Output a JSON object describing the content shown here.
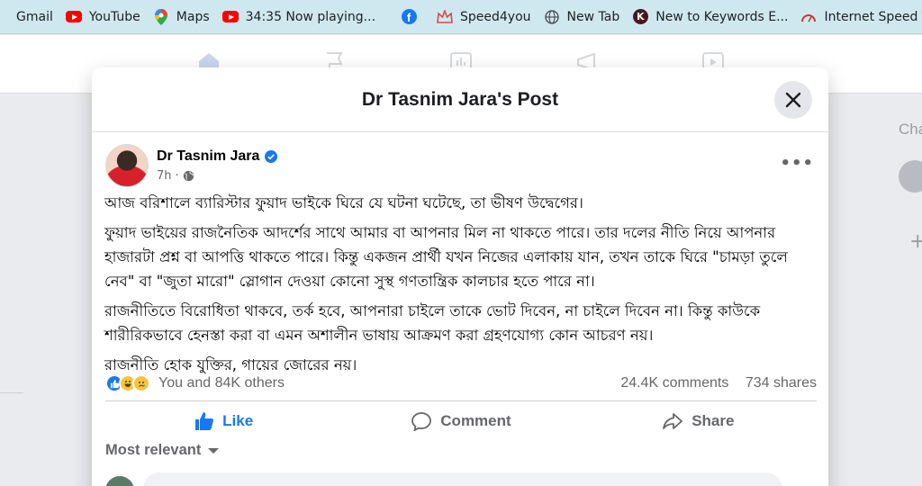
{
  "bookmarks": [
    {
      "label": "Gmail",
      "icon": "gmail-icon"
    },
    {
      "label": "YouTube",
      "icon": "youtube-icon"
    },
    {
      "label": "Maps",
      "icon": "maps-icon"
    },
    {
      "label": "34:35 Now playing...",
      "icon": "youtube-icon"
    },
    {
      "label": "",
      "icon": "facebook-icon"
    },
    {
      "label": "Speed4you",
      "icon": "crown-icon"
    },
    {
      "label": "New Tab",
      "icon": "globe-icon"
    },
    {
      "label": "New to Keywords E...",
      "icon": "k-icon"
    },
    {
      "label": "Internet Speed Test...",
      "icon": "speedometer-icon"
    }
  ],
  "background": {
    "right_header": "Cha"
  },
  "modal": {
    "title": "Dr Tasnim Jara's Post"
  },
  "post": {
    "author": "Dr Tasnim Jara",
    "time": "7h",
    "visibility_icon": "globe-icon",
    "paragraphs": [
      "আজ বরিশালে ব্যারিস্টার ফুয়াদ ভাইকে ঘিরে যে ঘটনা ঘটেছে, তা ভীষণ উদ্বেগের।",
      "ফুয়াদ ভাইয়ের রাজনৈতিক আদর্শের সাথে আমার বা আপনার মিল না থাকতে পারে। তার দলের নীতি নিয়ে আপনার হাজারটা প্রশ্ন বা আপত্তি থাকতে পারে। কিন্তু একজন প্রার্থী যখন নিজের এলাকায় যান, তখন তাকে ঘিরে \"চামড়া তুলে নেব\" বা \"জুতা মারো\" স্লোগান দেওয়া কোনো সুস্থ গণতান্ত্রিক কালচার হতে পারে না।",
      "রাজনীতিতে বিরোধিতা থাকবে, তর্ক হবে, আপনারা চাইলে তাকে ভোট দিবেন, না চাইলে দিবেন না। কিন্তু কাউকে শারীরিকভাবে হেনস্তা করা বা এমন অশালীন ভাষায় আক্রমণ করা গ্রহণযোগ্য কোন আচরণ নয়।",
      "রাজনীতি হোক যুক্তির, গায়ের জোরের নয়।"
    ],
    "reactions_text": "You and 84K others",
    "comments_count": "24.4K comments",
    "shares_count": "734 shares"
  },
  "actions": {
    "like": "Like",
    "comment": "Comment",
    "share": "Share"
  },
  "sort": {
    "label": "Most relevant"
  },
  "colors": {
    "accent": "#1877f2",
    "bookmark_bar": "#cfe8f0"
  }
}
